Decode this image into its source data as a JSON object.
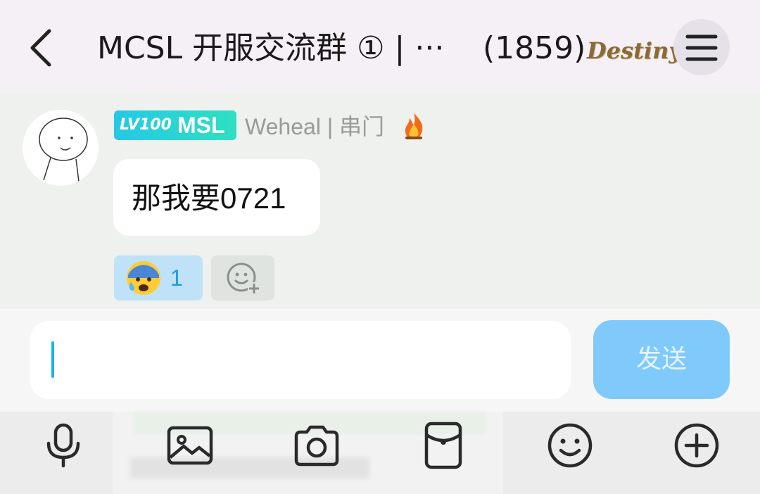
{
  "header": {
    "title": "MCSL 开服交流群 ① | ···",
    "member_count": "(1859)",
    "logo_text": "Destiny"
  },
  "message": {
    "level_badge": "LV100",
    "level_tag": "MSL",
    "sender": "Weheal | 串门",
    "text": "那我要0721",
    "reaction_emoji": "😰",
    "reaction_count": "1"
  },
  "composer": {
    "input_value": "",
    "send_label": "发送"
  },
  "toolbar": {
    "icons": [
      "microphone-icon",
      "image-icon",
      "camera-icon",
      "red-packet-icon",
      "emoji-icon",
      "plus-icon"
    ]
  },
  "colors": {
    "header_bg": "#f5f0f5",
    "chat_bg": "#eef1ee",
    "accent": "#18b4e8",
    "send_button": "#80c9fb",
    "reaction_bg": "#bfe2f8"
  }
}
